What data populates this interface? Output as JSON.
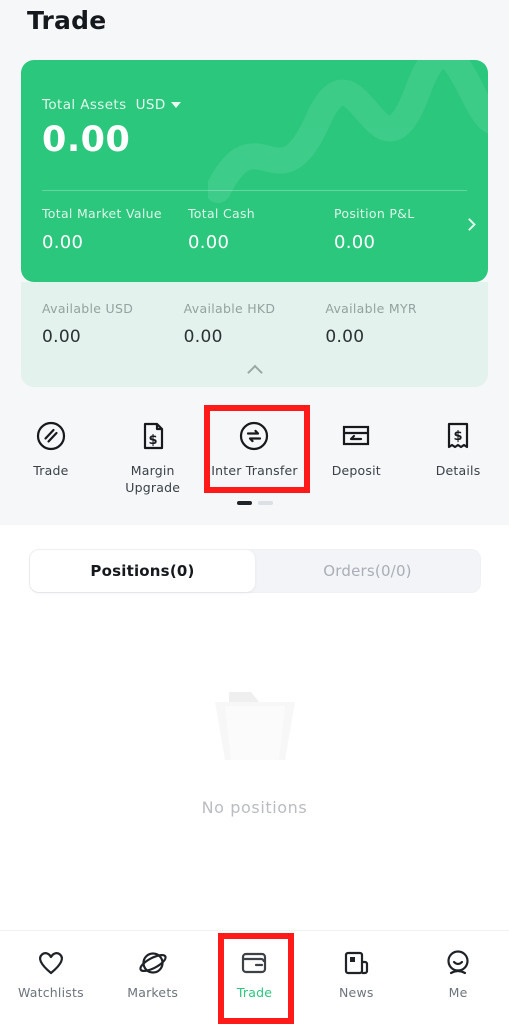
{
  "header": {
    "title": "Trade"
  },
  "asset_card": {
    "total_assets_label": "Total Assets",
    "currency": "USD",
    "currency_caret_icon": "caret-down-icon",
    "total_assets_value": "0.00",
    "detail_chevron_icon": "chevron-right-icon",
    "stats": [
      {
        "label": "Total Market Value",
        "value": "0.00"
      },
      {
        "label": "Total Cash",
        "value": "0.00"
      },
      {
        "label": "Position P&L",
        "value": "0.00"
      }
    ],
    "accent_color": "#2ac77d"
  },
  "available_panel": {
    "items": [
      {
        "label": "Available USD",
        "value": "0.00"
      },
      {
        "label": "Available HKD",
        "value": "0.00"
      },
      {
        "label": "Available MYR",
        "value": "0.00"
      }
    ],
    "collapse_icon": "chevron-up-icon",
    "background_color": "#e3f2ec"
  },
  "quick_actions": {
    "items": [
      {
        "label": "Trade",
        "icon": "trade-circle-icon"
      },
      {
        "label": "Margin Upgrade",
        "icon": "document-dollar-icon"
      },
      {
        "label": "Inter Transfer",
        "icon": "transfer-circle-icon"
      },
      {
        "label": "Deposit",
        "icon": "card-deposit-icon"
      },
      {
        "label": "Details",
        "icon": "receipt-dollar-icon"
      }
    ],
    "highlight_label": "Inter Transfer",
    "highlight_color": "#ff1a1a",
    "pager": {
      "total": 2,
      "active_index": 0
    }
  },
  "tabs": [
    {
      "label": "Positions(0)",
      "active": true
    },
    {
      "label": "Orders(0/0)",
      "active": false
    }
  ],
  "empty_state": {
    "icon": "empty-folder-icon",
    "message": "No  positions"
  },
  "bottom_nav": {
    "items": [
      {
        "label": "Watchlists",
        "icon": "heart-icon",
        "active": false
      },
      {
        "label": "Markets",
        "icon": "planet-icon",
        "active": false
      },
      {
        "label": "Trade",
        "icon": "wallet-icon",
        "active": true
      },
      {
        "label": "News",
        "icon": "newspaper-icon",
        "active": false
      },
      {
        "label": "Me",
        "icon": "person-icon",
        "active": false
      }
    ],
    "active_color": "#2ac77d",
    "highlight_color": "#ff1a1a"
  }
}
